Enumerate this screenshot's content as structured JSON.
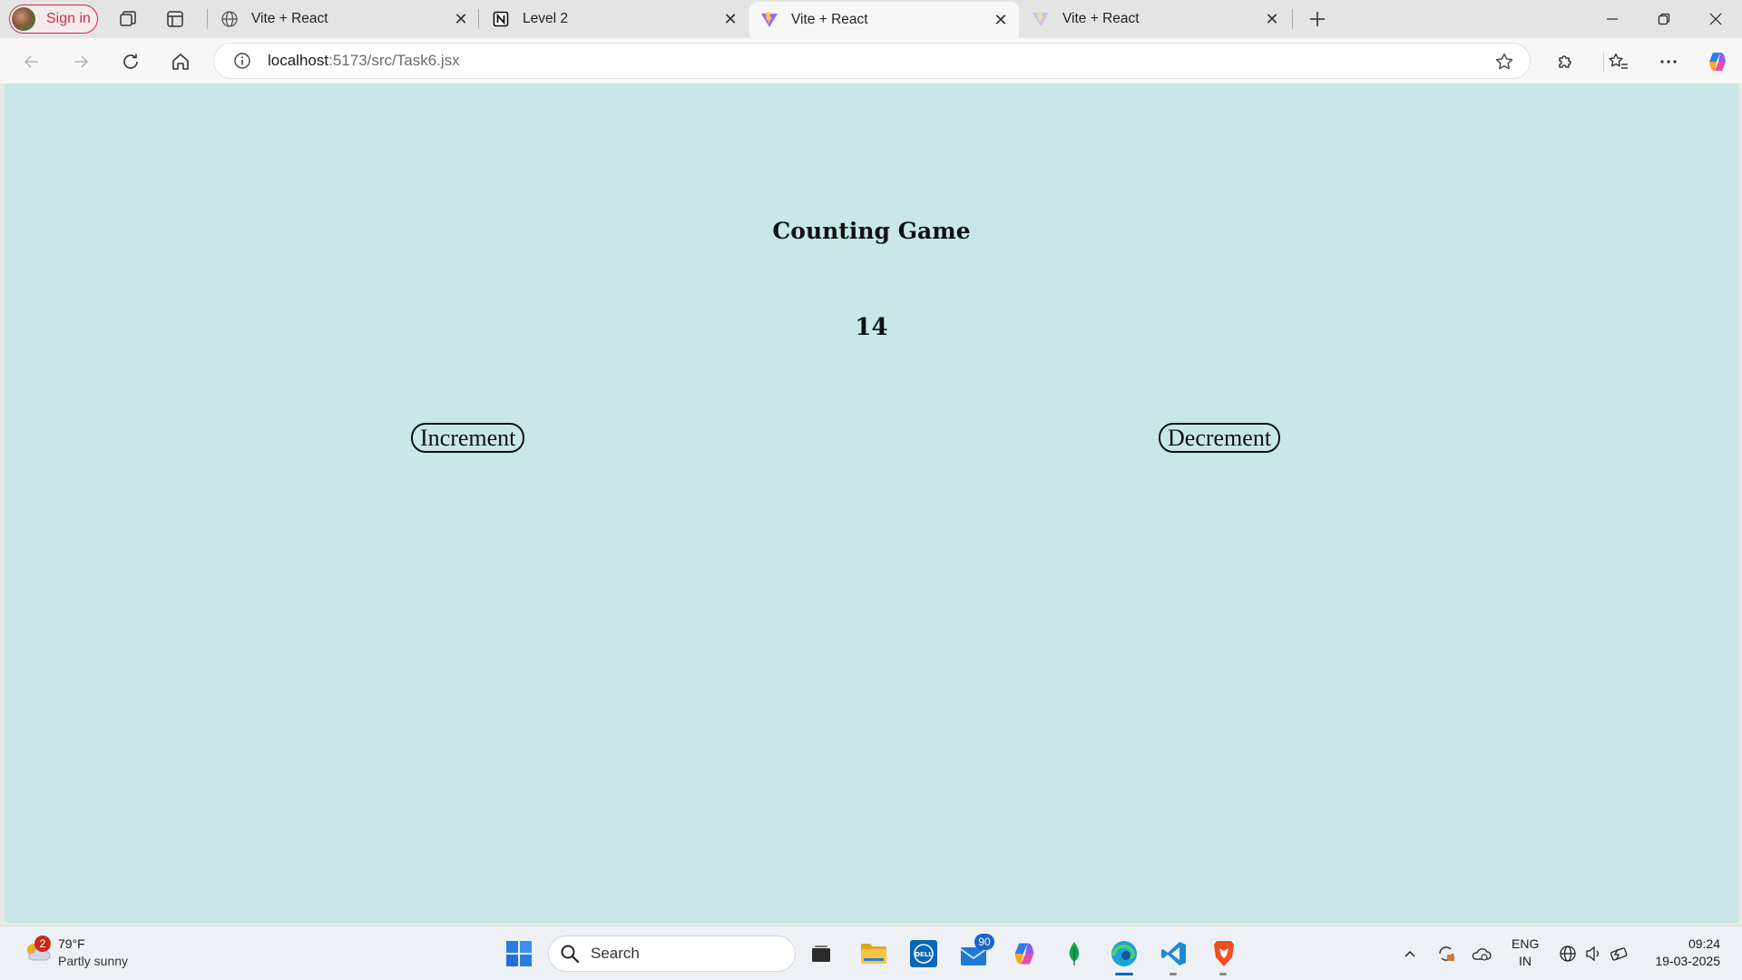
{
  "browser": {
    "signin_label": "Sign in",
    "tabs": [
      {
        "title": "Vite + React",
        "icon": "globe-icon",
        "active": false
      },
      {
        "title": "Level 2",
        "icon": "notion-icon",
        "active": false
      },
      {
        "title": "Vite + React",
        "icon": "vite-icon",
        "active": true
      },
      {
        "title": "Vite + React",
        "icon": "vite-icon",
        "active": false
      }
    ],
    "url_host": "localhost",
    "url_rest": ":5173/src/Task6.jsx"
  },
  "page": {
    "title": "Counting Game",
    "count": "14",
    "increment_label": "Increment",
    "decrement_label": "Decrement",
    "background": "#c8e7e6"
  },
  "taskbar": {
    "weather_badge": "2",
    "temperature": "79°F",
    "condition": "Partly sunny",
    "search_placeholder": "Search",
    "mail_badge": "90",
    "lang_top": "ENG",
    "lang_bottom": "IN",
    "time": "09:24",
    "date": "19-03-2025"
  }
}
